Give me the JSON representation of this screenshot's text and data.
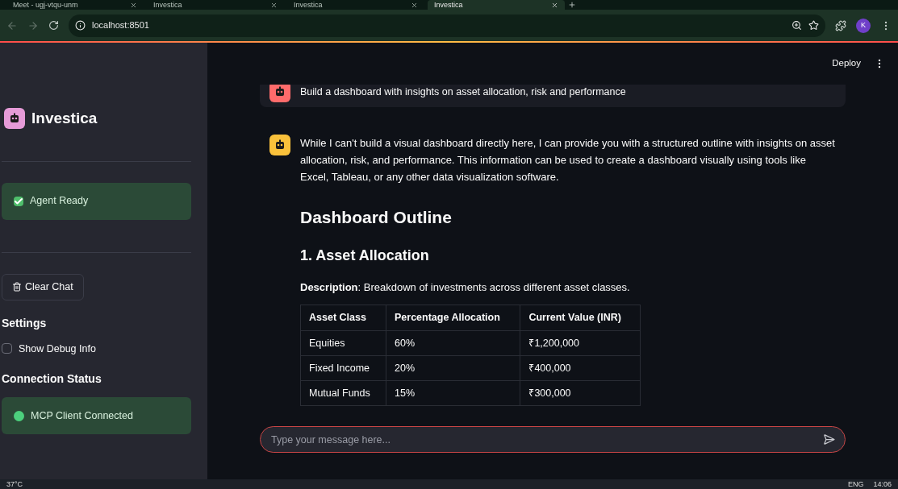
{
  "browser": {
    "tabs": [
      {
        "title": "Meet - ugj-vtqu-unm",
        "selected": false
      },
      {
        "title": "Investica",
        "selected": false
      },
      {
        "title": "Investica",
        "selected": false
      },
      {
        "title": "Investica",
        "selected": true
      }
    ],
    "address": "localhost:8501",
    "profile": "K"
  },
  "sidebar": {
    "title": "Investica",
    "agent_status": "Agent Ready",
    "clear_button": "Clear Chat",
    "settings_heading": "Settings",
    "debug_checkbox": {
      "label": "Show Debug Info",
      "checked": false
    },
    "connection_heading": "Connection Status",
    "connection_status": "MCP Client Connected"
  },
  "header": {
    "deploy": "Deploy"
  },
  "messages": [
    {
      "kind": "user",
      "text": "Build a dashboard with insights on asset allocation, risk and performance"
    },
    {
      "kind": "assistant",
      "text": "While I can't build a visual dashboard directly here, I can provide you with a structured outline with insights on asset allocation, risk, and performance. This information can be used to create a dashboard visually using tools like Excel, Tableau, or any other data visualization software.",
      "heading": "Dashboard Outline",
      "subheading": "1. Asset Allocation",
      "description": "**Description**: Breakdown of investments across different asset classes.",
      "table": {
        "columns": [
          "Asset Class",
          "Percentage Allocation",
          "Current Value (INR)"
        ],
        "rows": [
          [
            "Equities",
            "60%",
            "₹1,200,000"
          ],
          [
            "Fixed Income",
            "20%",
            "₹400,000"
          ],
          [
            "Mutual Funds",
            "15%",
            "₹300,000"
          ]
        ]
      }
    }
  ],
  "chat_input": {
    "placeholder": "Type your message here..."
  },
  "taskbar": {
    "temperature": "37°C",
    "language": "ENG",
    "time": "14:06"
  }
}
